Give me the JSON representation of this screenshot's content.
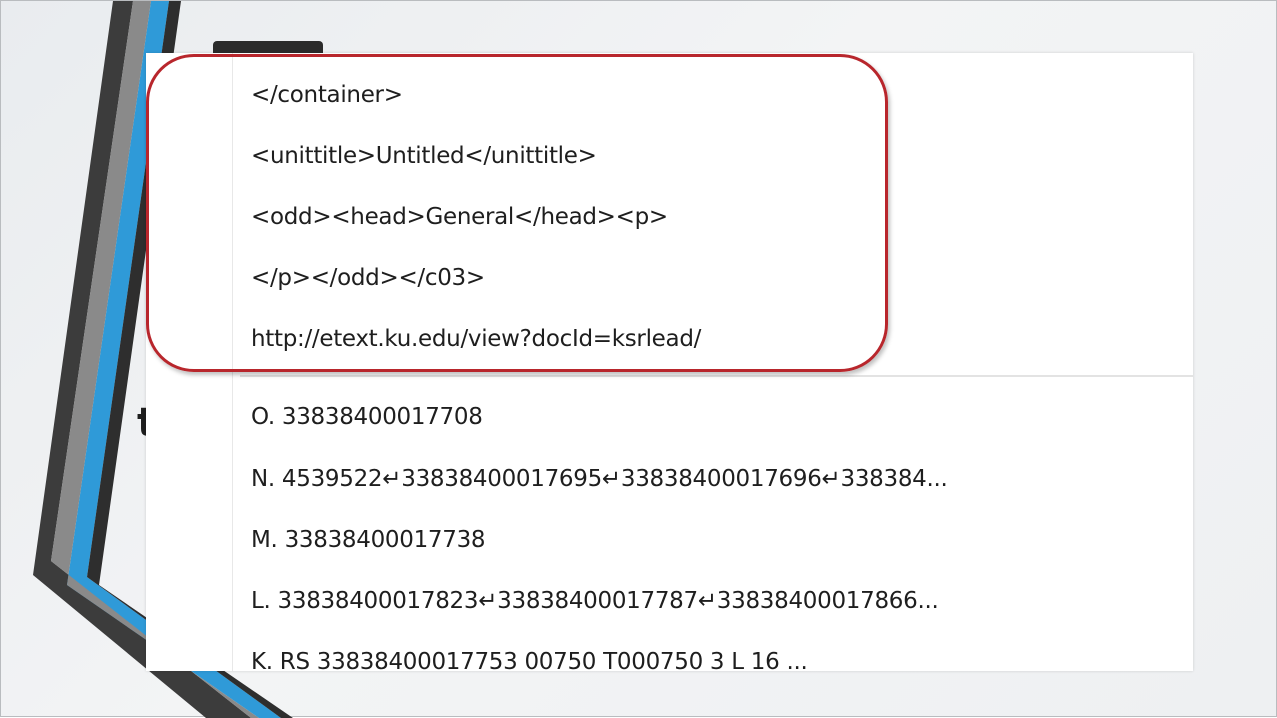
{
  "dropdown": {
    "highlighted_items": [
      {
        "text": "</container>"
      },
      {
        "text": "<unittitle>Untitled</unittitle>"
      },
      {
        "text": "<odd><head>General</head><p>"
      },
      {
        "text": "</p></odd></c03>"
      },
      {
        "text": "http://etext.ku.edu/view?docId=ksrlead/"
      }
    ],
    "history_items": [
      {
        "text": "O.  33838400017708"
      },
      {
        "text": "N.  4539522↵33838400017695↵33838400017696↵338384..."
      },
      {
        "text": "M.  33838400017738"
      },
      {
        "text": "L.  33838400017823↵33838400017787↵33838400017866..."
      },
      {
        "text": "K.  RS  33838400017753 00750  T000750   3 L     16  ..."
      }
    ]
  },
  "background": {
    "partial_glyph": "t"
  },
  "colors": {
    "highlight_ring": "#b8262c",
    "deco_blue": "#2f9ad8",
    "deco_dark": "#3c3c3c",
    "deco_light": "#8a8a8a"
  }
}
